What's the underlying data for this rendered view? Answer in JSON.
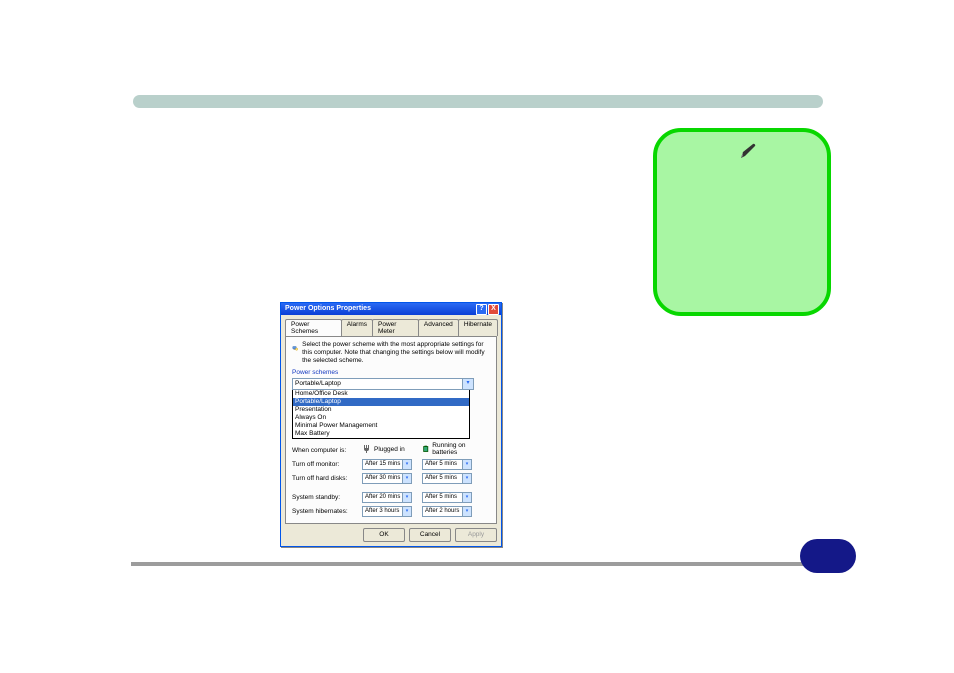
{
  "dialog": {
    "title": "Power Options Properties",
    "help_glyph": "?",
    "close_glyph": "X",
    "tabs": [
      "Power Schemes",
      "Alarms",
      "Power Meter",
      "Advanced",
      "Hibernate"
    ],
    "active_tab": 0,
    "description": "Select the power scheme with the most appropriate settings for this computer. Note that changing the settings below will modify the selected scheme.",
    "schemes_label": "Power schemes",
    "scheme_selected": "Portable/Laptop",
    "scheme_options": [
      "Home/Office Desk",
      "Portable/Laptop",
      "Presentation",
      "Always On",
      "Minimal Power Management",
      "Max Battery"
    ],
    "settings_label": "When computer is:",
    "col_headers": [
      "Plugged in",
      "Running on batteries"
    ],
    "rows": [
      {
        "label": "Turn off monitor:",
        "plugged": "After 15 mins",
        "battery": "After 5 mins"
      },
      {
        "label": "Turn off hard disks:",
        "plugged": "After 30 mins",
        "battery": "After 5 mins"
      },
      {
        "label": "System standby:",
        "plugged": "After 20 mins",
        "battery": "After 5 mins"
      },
      {
        "label": "System hibernates:",
        "plugged": "After 3 hours",
        "battery": "After 2 hours"
      }
    ],
    "buttons": {
      "ok": "OK",
      "cancel": "Cancel",
      "apply": "Apply"
    }
  },
  "glyphs": {
    "dropdown": "▾"
  }
}
